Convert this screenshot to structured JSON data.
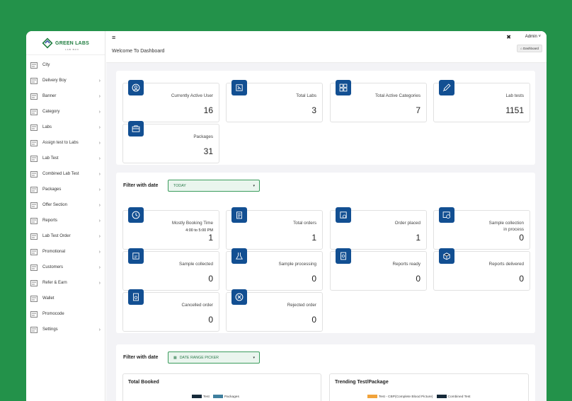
{
  "logo": {
    "name": "GREEN LABS",
    "tagline": "LAB BOX"
  },
  "sidebar": {
    "items": [
      {
        "label": "City",
        "icon": "building-icon",
        "chevron": false
      },
      {
        "label": "Delivery Boy",
        "icon": "truck-icon",
        "chevron": true
      },
      {
        "label": "Banner",
        "icon": "banner-icon",
        "chevron": true
      },
      {
        "label": "Category",
        "icon": "grid-icon",
        "chevron": true
      },
      {
        "label": "Labs",
        "icon": "lab-icon",
        "chevron": true
      },
      {
        "label": "Assign test to Labs",
        "icon": "assign-icon",
        "chevron": true
      },
      {
        "label": "Lab Test",
        "icon": "syringe-icon",
        "chevron": true
      },
      {
        "label": "Combined Lab Test",
        "icon": "combined-icon",
        "chevron": true
      },
      {
        "label": "Packages",
        "icon": "package-icon",
        "chevron": true
      },
      {
        "label": "Offer Section",
        "icon": "offer-icon",
        "chevron": true
      },
      {
        "label": "Reports",
        "icon": "report-icon",
        "chevron": true
      },
      {
        "label": "Lab Test Order",
        "icon": "order-icon",
        "chevron": true
      },
      {
        "label": "Promotional",
        "icon": "promo-icon",
        "chevron": true
      },
      {
        "label": "Customers",
        "icon": "customers-icon",
        "chevron": true
      },
      {
        "label": "Refer & Earn",
        "icon": "refer-icon",
        "chevron": true
      },
      {
        "label": "Wallet",
        "icon": "wallet-icon",
        "chevron": false
      },
      {
        "label": "Promocode",
        "icon": "tag-icon",
        "chevron": false
      },
      {
        "label": "Settings",
        "icon": "settings-icon",
        "chevron": true
      }
    ]
  },
  "topbar": {
    "menu_glyph": "≡",
    "welcome": "Welcome To Dashboard",
    "expand_glyph": "✖",
    "user": "Admin",
    "caret": "˅",
    "breadcrumb": "Dashboard",
    "home_glyph": "⌂"
  },
  "overview": [
    {
      "title": "Currently Active User",
      "value": "16",
      "icon": "user-icon"
    },
    {
      "title": "Total Labs",
      "value": "3",
      "icon": "microscope-icon"
    },
    {
      "title": "Total Active Categories",
      "value": "7",
      "icon": "categories-icon"
    },
    {
      "title": "Lab tests",
      "value": "1151",
      "icon": "test-tube-icon"
    },
    {
      "title": "Packages",
      "value": "31",
      "icon": "briefcase-icon"
    }
  ],
  "filter1": {
    "label": "Filter with date",
    "selected": "TODAY",
    "caret": "▾"
  },
  "orders": [
    {
      "title": "Mostly Booking Time",
      "sub": "4:00 to 5:00 PM",
      "value": "1",
      "icon": "clock-icon"
    },
    {
      "title": "Total orders",
      "value": "1",
      "icon": "clipboard-icon"
    },
    {
      "title": "Order placed",
      "value": "1",
      "icon": "box-icon"
    },
    {
      "title": "Sample collection",
      "title2": "in process",
      "value": "0",
      "icon": "collection-icon"
    },
    {
      "title": "Sample collected",
      "value": "0",
      "icon": "sample-icon"
    },
    {
      "title": "Sample processing",
      "value": "0",
      "icon": "flask-icon"
    },
    {
      "title": "Reports ready",
      "value": "0",
      "icon": "report-ready-icon"
    },
    {
      "title": "Reports delivered",
      "value": "0",
      "icon": "delivered-icon"
    },
    {
      "title": "Cancelled order",
      "value": "0",
      "icon": "cancel-icon"
    },
    {
      "title": "Rejected order",
      "value": "0",
      "icon": "reject-icon"
    }
  ],
  "filter2": {
    "label": "Filter with date",
    "selected": "DATE RANGE PICKER",
    "caret": "▾",
    "icon": "calendar-icon"
  },
  "charts": {
    "total_booked": {
      "title": "Total Booked",
      "legend": [
        {
          "name": "Test",
          "color": "#162a3a"
        },
        {
          "name": "Packages",
          "color": "#3f7f9e"
        }
      ]
    },
    "trending": {
      "title": "Trending Test/Package",
      "legend": [
        {
          "name": "Test - CBP(Complete Blood Picture)",
          "color": "#f1a33b"
        },
        {
          "name": "Combined Test",
          "color": "#162a3a"
        }
      ]
    }
  },
  "colors": {
    "brand_green": "#23924a",
    "icon_blue": "#124f92"
  }
}
